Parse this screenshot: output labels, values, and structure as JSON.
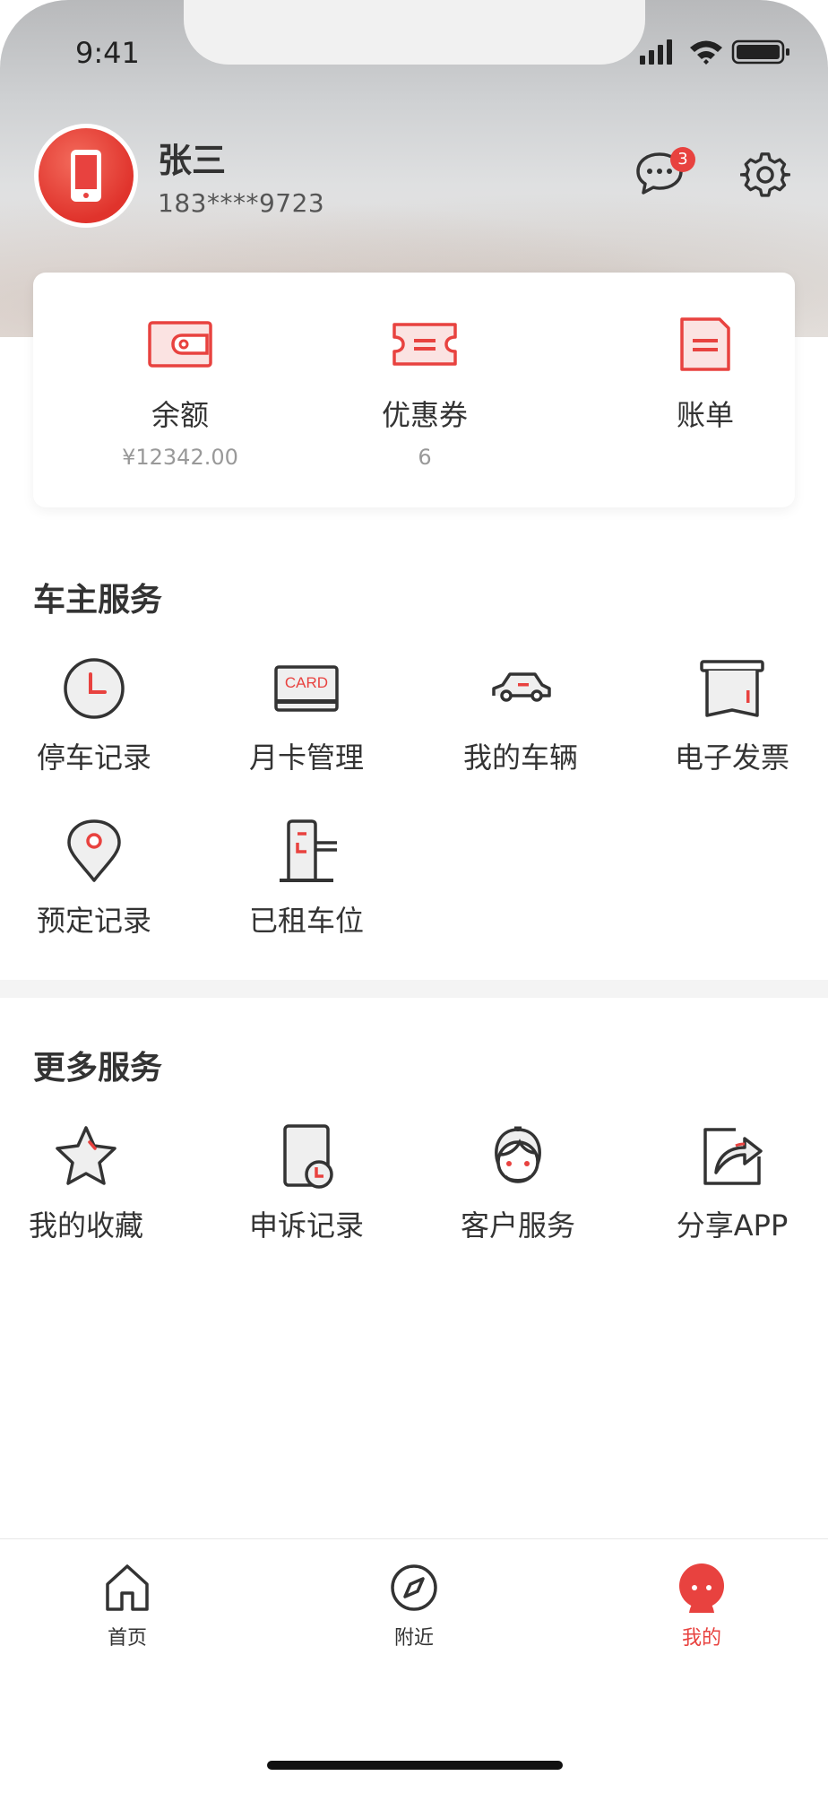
{
  "status_bar": {
    "time": "9:41"
  },
  "profile": {
    "name": "张三",
    "phone": "183****9723",
    "unread_count": "3"
  },
  "wallet": [
    {
      "label": "余额",
      "value": "¥12342.00",
      "icon": "wallet-icon"
    },
    {
      "label": "优惠券",
      "value": "6",
      "icon": "coupon-icon"
    },
    {
      "label": "账单",
      "value": "",
      "icon": "bill-icon"
    }
  ],
  "owner_services": {
    "title": "车主服务",
    "items": [
      {
        "label": "停车记录",
        "icon": "clock-icon"
      },
      {
        "label": "月卡管理",
        "icon": "card-icon",
        "icon_text": "CARD"
      },
      {
        "label": "我的车辆",
        "icon": "car-icon"
      },
      {
        "label": "电子发票",
        "icon": "invoice-icon"
      },
      {
        "label": "预定记录",
        "icon": "location-pin-icon"
      },
      {
        "label": "已租车位",
        "icon": "parking-gate-icon"
      }
    ]
  },
  "more_services": {
    "title": "更多服务",
    "items": [
      {
        "label": "我的收藏",
        "icon": "star-icon"
      },
      {
        "label": "申诉记录",
        "icon": "appeal-record-icon"
      },
      {
        "label": "客户服务",
        "icon": "customer-service-icon"
      },
      {
        "label": "分享APP",
        "icon": "share-icon"
      }
    ]
  },
  "tabbar": {
    "items": [
      {
        "label": "首页",
        "icon": "home-icon",
        "active": false
      },
      {
        "label": "附近",
        "icon": "compass-icon",
        "active": false
      },
      {
        "label": "我的",
        "icon": "profile-icon",
        "active": true
      }
    ]
  },
  "colors": {
    "accent": "#e8423f",
    "text": "#333333",
    "muted": "#999999"
  }
}
